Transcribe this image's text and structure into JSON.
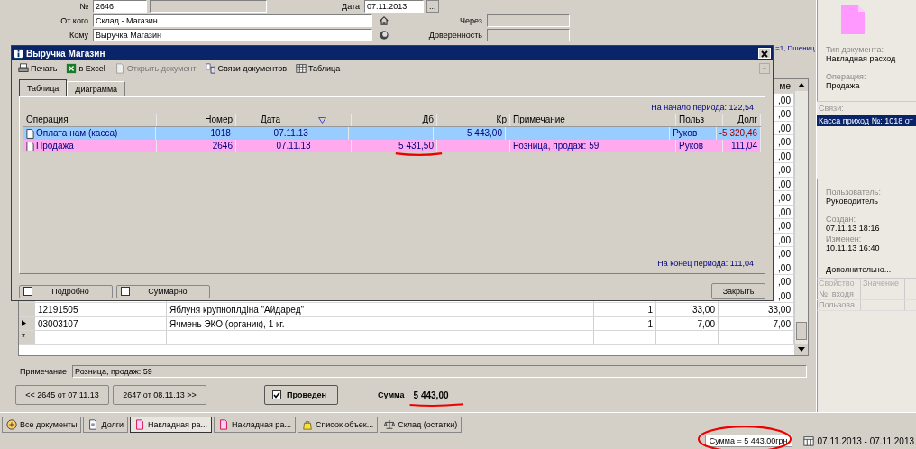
{
  "header": {
    "number_label": "№",
    "number": "2646",
    "date_label": "Дата",
    "date": "07.11.2013",
    "date_button": "...",
    "from_label": "От кого",
    "from": "Склад - Магазин",
    "via_label": "Через",
    "to_label": "Кому",
    "to": "Выручка Магазин",
    "proxy_label": "Доверенность"
  },
  "grid_caption": "=1, Пшениц",
  "grid": {
    "last_header": "ме",
    "rows": [
      {
        "sum": ",00"
      },
      {
        "sum": ",00"
      },
      {
        "sum": ",00"
      },
      {
        "sum": ",00"
      },
      {
        "sum": ",00"
      },
      {
        "sum": ",00"
      },
      {
        "sum": ",00"
      },
      {
        "sum": ",00"
      },
      {
        "sum": ",00"
      },
      {
        "sum": ",00"
      },
      {
        "sum": ",00"
      },
      {
        "sum": ",00"
      },
      {
        "sum": ",00"
      },
      {
        "sum": ",00"
      },
      {
        "sum": ",00"
      },
      {
        "current": false,
        "code": "12191505",
        "name": "Яблуня  крупноплдіна \"Айдаред\"",
        "qty": "1",
        "price": "33,00",
        "sum": "33,00"
      },
      {
        "current": true,
        "code": "03003107",
        "name": "Ячмень ЭКО (органик), 1 кг.",
        "qty": "1",
        "price": "7,00",
        "sum": "7,00"
      }
    ],
    "new_row": "*"
  },
  "note_label": "Примечание",
  "note": "Розница, продаж: 59",
  "prev_button": "<< 2645 от 07.11.13",
  "next_button": "2647 от 08.11.13 >>",
  "posted": {
    "label": "Проведен",
    "checked": true
  },
  "total_label": "Сумма",
  "total": "5 443,00",
  "dialog": {
    "title": "Выручка Магазин",
    "toolbar": [
      {
        "label": "Печать",
        "disabled": false
      },
      {
        "label": "в Excel",
        "disabled": false
      },
      {
        "label": "Открыть документ",
        "disabled": true
      },
      {
        "label": "Связи документов",
        "disabled": false
      },
      {
        "label": "Таблица",
        "disabled": false
      }
    ],
    "tabs": [
      {
        "label": "Таблица",
        "selected": true
      },
      {
        "label": "Диаграмма",
        "selected": false
      }
    ],
    "start_balance": "На начало периода:  122,54",
    "columns": [
      "Операция",
      "Номер",
      "Дата",
      "Дб",
      "Кр",
      "Примечание",
      "Польз",
      "Долг"
    ],
    "rows": [
      {
        "operation": "Оплата нам (касса)",
        "number": "1018",
        "date": "07.11.13",
        "db": "",
        "kr": "5 443,00",
        "note": "",
        "user": "Руков",
        "debt": "-5 320,46",
        "color": "#99ccff"
      },
      {
        "operation": "Продажа",
        "number": "2646",
        "date": "07.11.13",
        "db": "5 431,50",
        "kr": "",
        "note": "Розница, продаж: 59",
        "user": "Руков",
        "debt": "111,04",
        "color": "#ffaaee"
      }
    ],
    "end_balance": "На конец периода:  111,04",
    "detailed": {
      "label": "Подробно",
      "checked": false
    },
    "summary": {
      "label": "Суммарно",
      "checked": false
    },
    "close_button": "Закрыть"
  },
  "side": {
    "type_label": "Тип документа:",
    "type": "Накладная расход",
    "operation_label": "Операция:",
    "operation": "Продажа",
    "links_header": "Связи:",
    "links": [
      {
        "label": "Касса приход №: 1018 от",
        "selected": true
      }
    ],
    "user_label": "Пользователь:",
    "user": "Руководитель",
    "created_label": "Создан:",
    "created": "07.11.13  18:16",
    "changed_label": "Изменен:",
    "changed": "10.11.13  16:40",
    "more": "Дополнительно...",
    "prop_columns": [
      "Свойство",
      "Значение"
    ],
    "props": [
      "№_входя",
      "Пользова"
    ]
  },
  "taskbar": [
    {
      "label": "Все документы",
      "selected": false
    },
    {
      "label": "Долги",
      "selected": false
    },
    {
      "label": "Накладная ра...",
      "selected": true
    },
    {
      "label": "Накладная ра...",
      "selected": false
    },
    {
      "label": "Список объек...",
      "selected": false
    },
    {
      "label": "Склад (остатки)",
      "selected": false
    }
  ],
  "status_sum": "Сумма = 5 443,00грн",
  "period": "07.11.2013 - 07.11.2013"
}
